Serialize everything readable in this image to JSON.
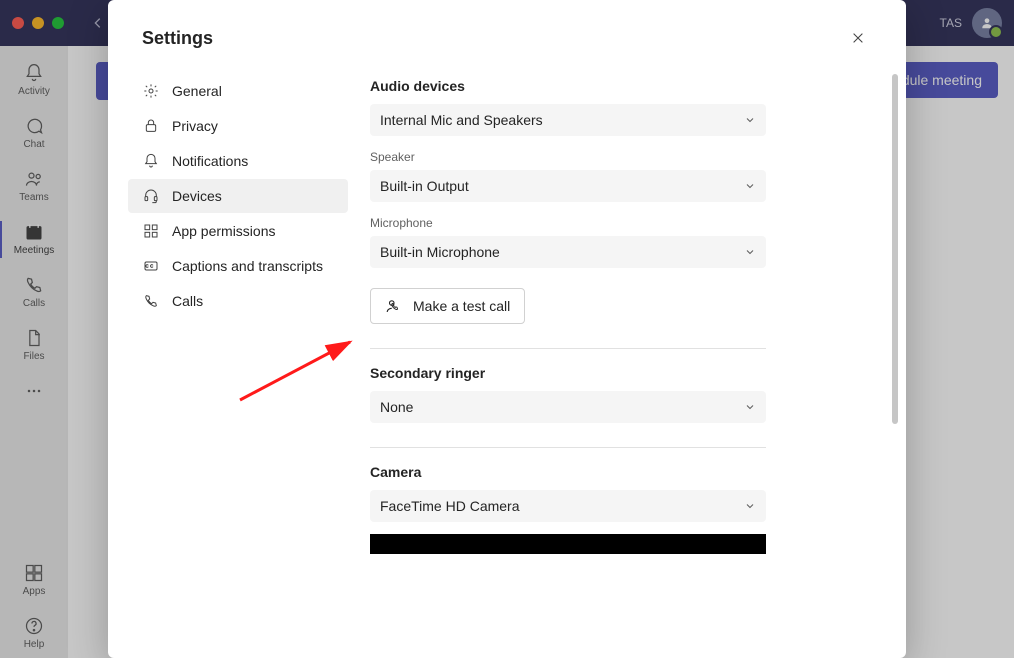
{
  "titlebar": {
    "user_initials": "TAS"
  },
  "sidenav": {
    "items": [
      {
        "label": "Activity"
      },
      {
        "label": "Chat"
      },
      {
        "label": "Teams"
      },
      {
        "label": "Meetings"
      },
      {
        "label": "Calls"
      },
      {
        "label": "Files"
      }
    ],
    "bottom": [
      {
        "label": "Apps"
      },
      {
        "label": "Help"
      }
    ]
  },
  "main": {
    "schedule_button": "dule meeting"
  },
  "dialog": {
    "title": "Settings",
    "nav": [
      {
        "label": "General"
      },
      {
        "label": "Privacy"
      },
      {
        "label": "Notifications"
      },
      {
        "label": "Devices"
      },
      {
        "label": "App permissions"
      },
      {
        "label": "Captions and transcripts"
      },
      {
        "label": "Calls"
      }
    ],
    "content": {
      "audio_devices_heading": "Audio devices",
      "audio_device_value": "Internal Mic and Speakers",
      "speaker_label": "Speaker",
      "speaker_value": "Built-in Output",
      "microphone_label": "Microphone",
      "microphone_value": "Built-in Microphone",
      "test_call_button": "Make a test call",
      "secondary_ringer_heading": "Secondary ringer",
      "secondary_ringer_value": "None",
      "camera_heading": "Camera",
      "camera_value": "FaceTime HD Camera"
    }
  }
}
